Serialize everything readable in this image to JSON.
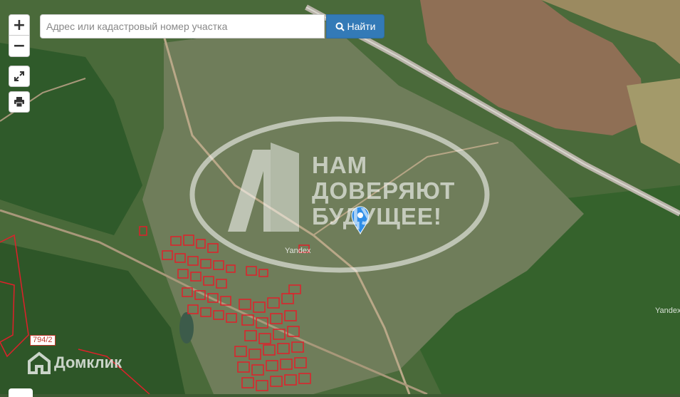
{
  "search": {
    "placeholder": "Адрес или кадастровый номер участка",
    "button_label": "Найти",
    "button_icon": "search-icon"
  },
  "controls": {
    "zoom_in": "+",
    "zoom_out": "−",
    "fullscreen_icon": "expand-icon",
    "print_icon": "print-icon"
  },
  "watermark": {
    "lines": [
      "НАМ",
      "ДОВЕРЯЮТ",
      "БУДУЩЕЕ!"
    ]
  },
  "map_labels": {
    "parcel_number": "794/2",
    "yandex_1": "Yandex",
    "yandex_2": "Yandex",
    "domclick": "Домклик"
  },
  "colors": {
    "search_button": "#337ab7",
    "parcel_outline": "#e0202a",
    "marker": "#2f8ee8",
    "forest": "#2f5a2a",
    "field": "#8f6f55"
  }
}
